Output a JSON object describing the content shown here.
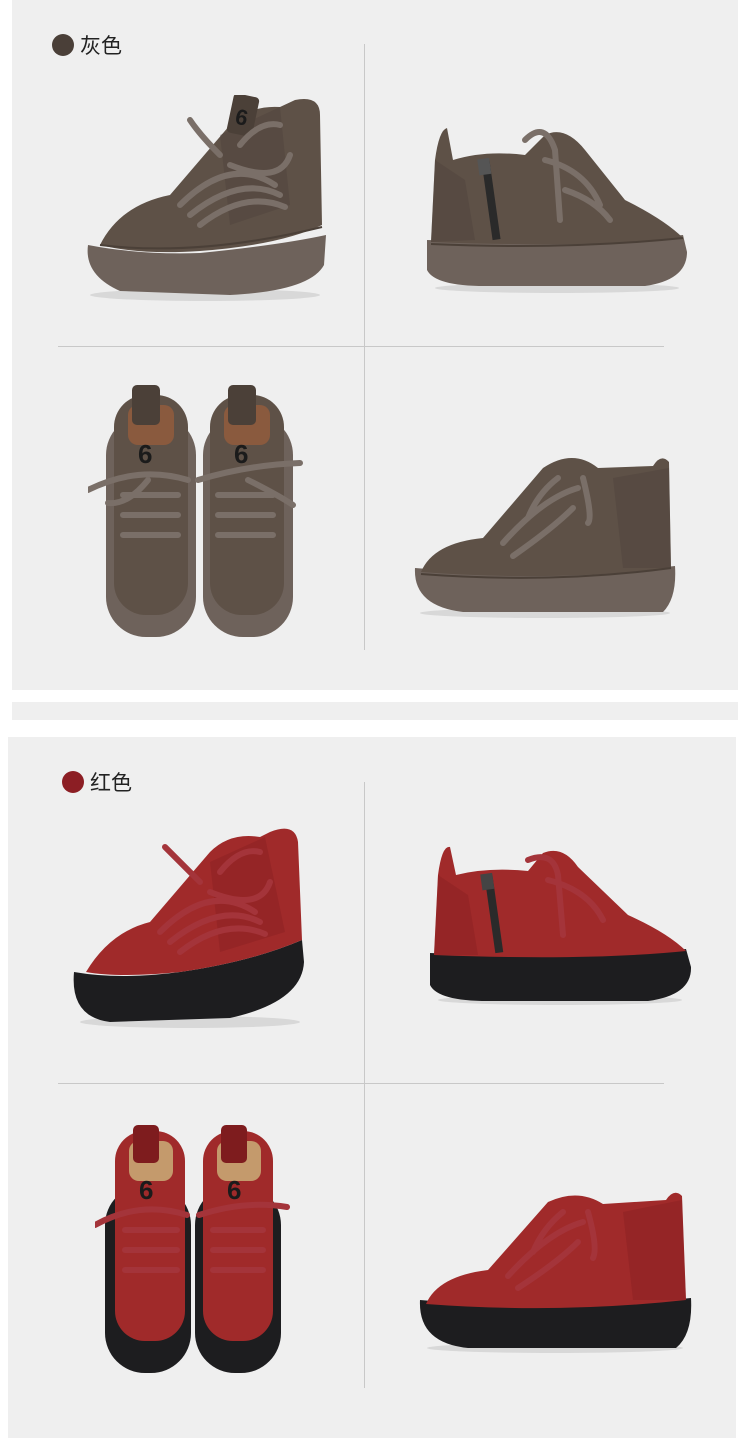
{
  "sections": [
    {
      "label": "灰色",
      "swatch_color": "#4a3f38",
      "upper_color": "#5e5147",
      "upper_shade": "#4b4038",
      "sole_color": "#6e625b",
      "lace_color": "#7a6f68",
      "lining_color": "#8a5a3e",
      "tag_text": "6"
    },
    {
      "label": "红色",
      "swatch_color": "#8c1e24",
      "upper_color": "#a02a2a",
      "upper_shade": "#7e1c1e",
      "sole_color": "#1d1d1f",
      "lace_color": "#a4343a",
      "lining_color": "#c49a6c",
      "tag_text": "6"
    }
  ]
}
